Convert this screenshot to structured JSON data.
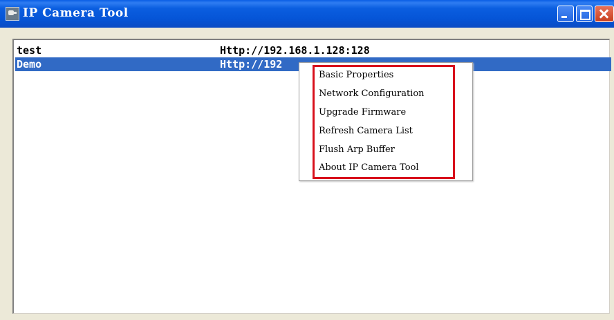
{
  "window": {
    "title": "IP Camera Tool",
    "title_icon": "camera-icon"
  },
  "titlebar_buttons": {
    "minimize": "minimize-icon",
    "maximize": "maximize-icon",
    "close": "close-icon"
  },
  "cameras": [
    {
      "name": "test",
      "url": "Http://192.168.1.128:128",
      "selected": false
    },
    {
      "name": "Demo",
      "url": "Http://192",
      "selected": true
    }
  ],
  "context_menu": {
    "items": [
      "Basic Properties",
      "Network Configuration",
      "Upgrade Firmware",
      "Refresh Camera List",
      "Flush Arp Buffer",
      "About IP Camera Tool"
    ]
  },
  "colors": {
    "selection": "#316ac5",
    "highlight_box": "#d8101c",
    "titlebar": "#0554d6"
  }
}
